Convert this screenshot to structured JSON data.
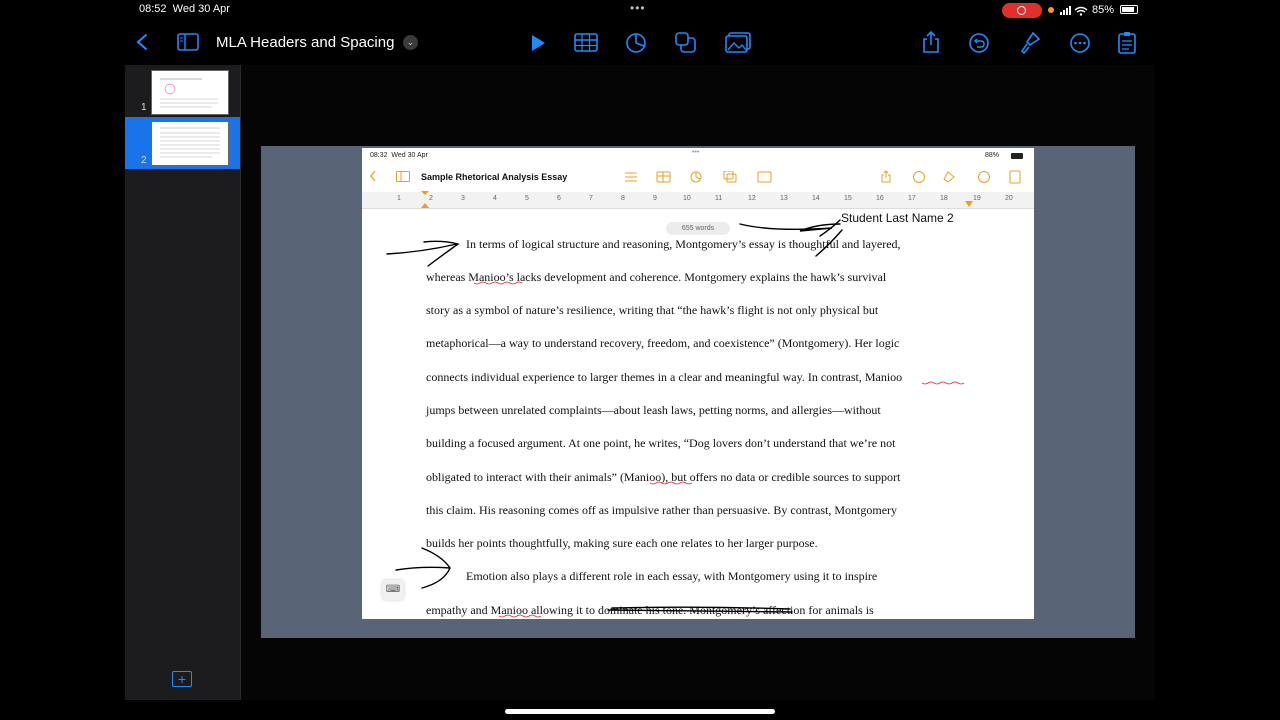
{
  "status_bar": {
    "time": "08:52",
    "date": "Wed 30 Apr",
    "dots": "•••",
    "battery": "85%"
  },
  "toolbar": {
    "back_icon": "chevron-left-icon",
    "title": "MLA Headers and Spacing",
    "accent": "#1e8cff"
  },
  "sidebar": {
    "slides": [
      {
        "number": "1"
      },
      {
        "number": "2"
      }
    ],
    "selected_color": "#1a73e8"
  },
  "embedded": {
    "status_time": "08:32",
    "status_date": "Wed 30 Apr",
    "status_dots": "•••",
    "battery": "88%",
    "title": "Sample Rhetorical Analysis Essay",
    "ruler_numbers": [
      "1",
      "2",
      "3",
      "4",
      "5",
      "6",
      "7",
      "8",
      "9",
      "10",
      "11",
      "12",
      "13",
      "14",
      "15",
      "16",
      "17",
      "18",
      "19",
      "20"
    ],
    "word_count": "655 words",
    "header": "Student Last Name 2",
    "lines": [
      "In terms of logical structure and reasoning, Montgomery’s essay is thoughtful and layered,",
      "whereas Manioo’s lacks development and coherence. Montgomery explains the hawk’s survival",
      "story as a symbol of nature’s resilience, writing that “the hawk’s flight is not only physical but",
      "metaphorical—a way to understand recovery, freedom, and coexistence” (Montgomery). Her logic",
      "connects individual experience to larger themes in a clear and meaningful way. In contrast, Manioo",
      "jumps between unrelated complaints—about leash laws, petting norms, and allergies—without",
      "building a focused argument. At one point, he writes, “Dog lovers don’t understand that we’re not",
      "obligated to interact with their animals” (Manioo), but offers no data or credible sources to support",
      "this claim. His reasoning comes off as impulsive rather than persuasive. By contrast, Montgomery",
      "builds her points thoughtfully, making sure each one relates to her larger purpose.",
      "Emotion also plays a different role in each essay, with Montgomery using it to inspire",
      "empathy and Manioo allowing it to dominate his tone. Montgomery’s affection for animals is"
    ]
  }
}
